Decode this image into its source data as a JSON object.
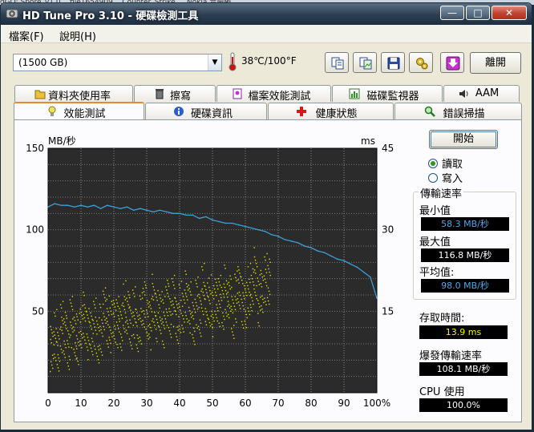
{
  "background_titlebar": "dGO:    Spore_v1.0...   file1654909...    Counter_Strike       ...    Nokia 音樂編...",
  "window": {
    "title": "HD Tune Pro 3.10 - 硬碟檢測工具",
    "minimize_label": "—",
    "maximize_label": "□",
    "close_label": "✕"
  },
  "menu": {
    "items": [
      {
        "label": "檔案(F)"
      },
      {
        "label": "說明(H)"
      }
    ]
  },
  "toolbar": {
    "drive_value": "(1500 GB)",
    "temperature": "38℃/100°F",
    "buttons": [
      {
        "name": "copy-text-button",
        "icon": "copy-icon"
      },
      {
        "name": "copy-screenshot-button",
        "icon": "copy-picture-icon"
      },
      {
        "name": "save-button",
        "icon": "floppy-disk-icon"
      },
      {
        "name": "options-button",
        "icon": "gears-icon"
      },
      {
        "name": "download-button",
        "icon": "download-arrow-icon"
      }
    ],
    "exit_label": "離開"
  },
  "tabs": {
    "row_top": [
      {
        "label": "資料夾使用率",
        "icon": "folder-icon"
      },
      {
        "label": "擦寫",
        "icon": "trash-icon"
      },
      {
        "label": "檔案效能測試",
        "icon": "document-icon"
      },
      {
        "label": "磁碟監視器",
        "icon": "chart-icon"
      },
      {
        "label": "AAM",
        "icon": "speaker-icon"
      }
    ],
    "row_bottom": [
      {
        "label": "效能測試",
        "icon": "lightbulb-icon",
        "active": true
      },
      {
        "label": "硬碟資訊",
        "icon": "info-icon"
      },
      {
        "label": "健康狀態",
        "icon": "red-cross-icon"
      },
      {
        "label": "錯誤掃描",
        "icon": "magnifier-icon"
      }
    ]
  },
  "controls": {
    "start_label": "開始",
    "mode_options": [
      {
        "label": "讀取",
        "selected": true
      },
      {
        "label": "寫入",
        "selected": false
      }
    ]
  },
  "results": {
    "transfer_group_title": "傳輸速率",
    "min_label": "最小值",
    "min_value": "58.3 MB/秒",
    "max_label": "最大值",
    "max_value": "116.8 MB/秒",
    "avg_label": "平均值:",
    "avg_value": "98.0 MB/秒",
    "access_label": "存取時間:",
    "access_value": "13.9 ms",
    "burst_label": "爆發傳輸速率",
    "burst_value": "108.1 MB/秒",
    "cpu_label": "CPU 使用",
    "cpu_value": "100.0%"
  },
  "chart_data": {
    "type": "line",
    "ylabel_left": "MB/秒",
    "ylabel_right": "ms",
    "y_ticks_left": [
      "150",
      "100",
      "50"
    ],
    "y_ticks_right": [
      "45",
      "30",
      "15"
    ],
    "x_ticks": [
      "0",
      "10",
      "20",
      "30",
      "40",
      "50",
      "60",
      "70",
      "80",
      "90",
      "100%"
    ],
    "xlim": [
      0,
      100
    ],
    "ylim_left": [
      0,
      150
    ],
    "ylim_right": [
      0,
      45
    ],
    "grid": true,
    "background": "#2b2b2b",
    "series": [
      {
        "color": "#3aa0d8",
        "axis": "left",
        "x": [
          0,
          2,
          4,
          6,
          8,
          10,
          12,
          14,
          16,
          18,
          20,
          22,
          24,
          26,
          28,
          30,
          32,
          34,
          36,
          38,
          40,
          42,
          44,
          46,
          48,
          50,
          52,
          54,
          56,
          58,
          60,
          62,
          64,
          66,
          68,
          70,
          72,
          74,
          76,
          78,
          80,
          82,
          84,
          86,
          88,
          90,
          92,
          94,
          96,
          98,
          100
        ],
        "values": [
          114,
          116,
          115,
          115,
          114,
          115,
          114,
          115,
          113,
          115,
          114,
          113,
          114,
          112,
          113,
          112,
          111,
          112,
          111,
          110,
          110,
          109,
          109,
          107,
          108,
          106,
          105,
          104,
          104,
          103,
          102,
          101,
          100,
          99,
          97,
          96,
          94,
          93,
          92,
          90,
          89,
          87,
          86,
          84,
          82,
          81,
          79,
          77,
          74,
          71,
          58
        ]
      },
      {
        "color": "#e2e200",
        "axis": "right",
        "type": "scatter",
        "description": "access time points",
        "points_hint": "dense band rising from ~10ms at 0% to ~15ms near 60%",
        "x": [
          1,
          2,
          3,
          4,
          5,
          6,
          7,
          8,
          9,
          10,
          11,
          12,
          13,
          14,
          15,
          16,
          17,
          18,
          19,
          20,
          21,
          22,
          23,
          24,
          25,
          26,
          27,
          28,
          29,
          30,
          31,
          32,
          33,
          34,
          35,
          36,
          37,
          38,
          39,
          40,
          41,
          42,
          43,
          44,
          45,
          46,
          47,
          48,
          49,
          50,
          51,
          52,
          53,
          54,
          55,
          56,
          57,
          58,
          59,
          60,
          61,
          62,
          63,
          64,
          65,
          66,
          67
        ],
        "values": [
          9,
          11,
          8,
          12,
          10,
          9,
          13,
          11,
          10,
          12,
          14,
          11,
          12,
          13,
          10,
          12,
          15,
          13,
          12,
          14,
          13,
          12,
          16,
          14,
          13,
          15,
          12,
          14,
          16,
          15,
          13,
          17,
          14,
          15,
          13,
          16,
          15,
          17,
          14,
          16,
          15,
          18,
          16,
          14,
          17,
          15,
          19,
          16,
          17,
          15,
          18,
          17,
          16,
          19,
          17,
          15,
          18,
          20,
          17,
          16,
          19,
          18,
          22,
          17,
          19,
          21,
          20
        ]
      }
    ]
  }
}
